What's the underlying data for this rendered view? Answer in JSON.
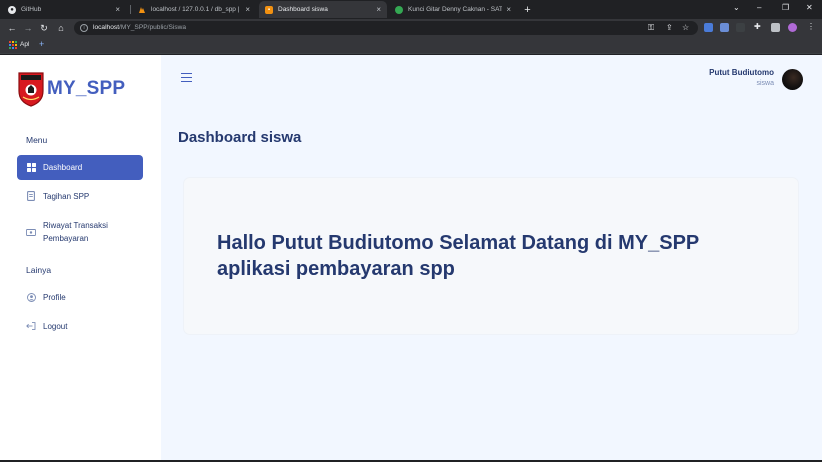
{
  "browser": {
    "tabs": [
      {
        "title": "GitHub",
        "active": false
      },
      {
        "title": "localhost / 127.0.0.1 / db_spp | p",
        "active": false
      },
      {
        "title": "Dashboard siswa",
        "active": true
      },
      {
        "title": "Kunci Gitar Denny Caknan - SATU",
        "active": false
      }
    ],
    "new_tab": "+",
    "url_host": "localhost",
    "url_path": "/MY_SPP/public/Siswa",
    "bookmarks": {
      "apps_label": "Apl",
      "add": "+"
    }
  },
  "sidebar": {
    "brand": "MY_SPP",
    "section_menu": "Menu",
    "section_other": "Lainya",
    "items": [
      {
        "label": "Dashboard",
        "icon": "grid-icon",
        "active": true
      },
      {
        "label": "Tagihan SPP",
        "icon": "receipt-icon",
        "active": false
      },
      {
        "label": "Riwayat Transaksi\nPembayaran",
        "icon": "cash-icon",
        "active": false
      },
      {
        "label": "Profile",
        "icon": "user-circle-icon",
        "active": false
      },
      {
        "label": "Logout",
        "icon": "logout-icon",
        "active": false
      }
    ]
  },
  "topbar": {
    "user_name": "Putut Budiutomo",
    "user_role": "siswa"
  },
  "main": {
    "heading": "Dashboard siswa",
    "greeting": "Hallo Putut Budiutomo Selamat Datang di MY_SPP aplikasi pembayaran spp"
  },
  "colors": {
    "primary": "#435ebe",
    "heading": "#25396f",
    "page_bg": "#f2f7ff",
    "sidebar_bg": "#ffffff",
    "card_bg": "#f6f8fb"
  }
}
